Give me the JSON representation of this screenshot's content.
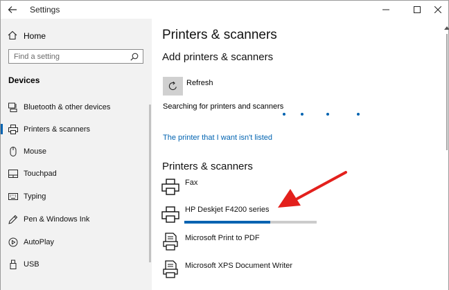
{
  "window": {
    "title": "Settings"
  },
  "sidebar": {
    "home_label": "Home",
    "search_placeholder": "Find a setting",
    "section_title": "Devices",
    "items": [
      {
        "label": "Bluetooth & other devices",
        "icon": "bluetooth-devices-icon"
      },
      {
        "label": "Printers & scanners",
        "icon": "printer-icon",
        "selected": true
      },
      {
        "label": "Mouse",
        "icon": "mouse-icon"
      },
      {
        "label": "Touchpad",
        "icon": "touchpad-icon"
      },
      {
        "label": "Typing",
        "icon": "keyboard-icon"
      },
      {
        "label": "Pen & Windows Ink",
        "icon": "pen-icon"
      },
      {
        "label": "AutoPlay",
        "icon": "autoplay-icon"
      },
      {
        "label": "USB",
        "icon": "usb-icon"
      }
    ]
  },
  "main": {
    "page_title": "Printers & scanners",
    "add_section_title": "Add printers & scanners",
    "refresh_label": "Refresh",
    "searching_text": "Searching for printers and scanners",
    "not_listed_link": "The printer that I want isn't listed",
    "list_section_title": "Printers & scanners",
    "devices": [
      {
        "name": "Fax",
        "icon": "printer-icon"
      },
      {
        "name": "HP Deskjet F4200 series",
        "icon": "printer-icon",
        "install_progress": 0.65
      },
      {
        "name": "Microsoft Print to PDF",
        "icon": "pdf-printer-icon"
      },
      {
        "name": "Microsoft XPS Document Writer",
        "icon": "xps-printer-icon"
      }
    ]
  },
  "colors": {
    "accent": "#0063b1",
    "annotation_arrow": "#e3201c",
    "sidebar_bg": "#f2f2f2"
  }
}
